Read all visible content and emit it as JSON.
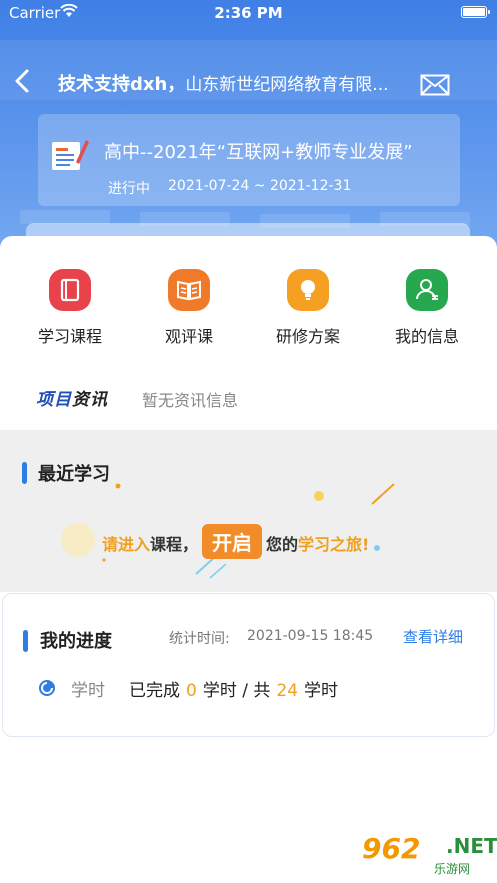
{
  "status_bar": {
    "carrier": "Carrier",
    "time": "2:36 PM"
  },
  "navbar": {
    "user_name": "技术支持dxh，",
    "organization": "山东新世纪网络教育有限..."
  },
  "project": {
    "title": "高中--2021年“互联网+教师专业发展”",
    "status": "进行中",
    "date_range": "2021-07-24 ~ 2021-12-31"
  },
  "menu": [
    {
      "label": "学习课程",
      "icon": "notebook-icon",
      "color": "#e8424a"
    },
    {
      "label": "观评课",
      "icon": "open-book-icon",
      "color": "#f07a2a"
    },
    {
      "label": "研修方案",
      "icon": "lightbulb-icon",
      "color": "#f5a023"
    },
    {
      "label": "我的信息",
      "icon": "user-icon",
      "color": "#27a84f"
    }
  ],
  "news": {
    "badge_part1": "项目",
    "badge_part2": "资讯",
    "empty_text": "暂无资讯信息"
  },
  "recent": {
    "title": "最近学习",
    "banner_before": "请进入",
    "banner_course": "课程，",
    "banner_button": "开启",
    "banner_your": "您的",
    "banner_after": "学习之旅!"
  },
  "progress": {
    "title": "我的进度",
    "stat_label": "统计时间:",
    "stat_time": "2021-09-15 18:45",
    "detail_link": "查看详细",
    "hours_label": "学时",
    "completed_label": "已完成",
    "completed_value": "0",
    "hours_unit": "学时",
    "total_label": "/ 共",
    "total_value": "24",
    "total_unit": "学时"
  },
  "watermark": {
    "number": "962",
    "suffix": ".NET",
    "name": "乐游网"
  },
  "colors": {
    "accent": "#2d7de6",
    "highlight": "#f0a020",
    "header": "#3f7fe6"
  }
}
